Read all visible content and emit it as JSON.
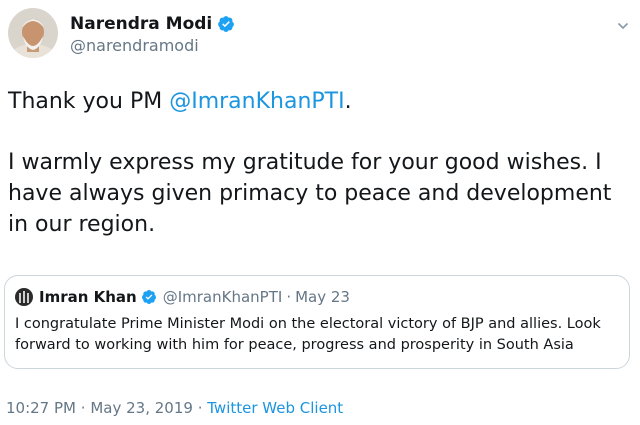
{
  "author": {
    "name": "Narendra Modi",
    "handle": "@narendramodi",
    "verified": true,
    "avatar_icon": "profile-photo"
  },
  "tweet": {
    "line1_prefix": "Thank you PM ",
    "line1_mention": "@ImranKhanPTI",
    "line1_suffix": ".",
    "paragraph2": "I warmly express my gratitude for your good wishes. I have always given primacy to peace and development in our region."
  },
  "quoted_tweet": {
    "name": "Imran Khan",
    "handle": "@ImranKhanPTI",
    "separator": "·",
    "date": "May 23",
    "text": "I congratulate Prime Minister Modi on the electoral victory of BJP and allies. Look forward to working with him for peace, progress and prosperity in South Asia"
  },
  "meta": {
    "time": "10:27 PM",
    "separator": "·",
    "date": "May 23, 2019",
    "source": "Twitter Web Client"
  },
  "colors": {
    "link": "#1b95e0",
    "secondary_text": "#657786",
    "border": "#ccd6dd",
    "verified_badge": "#1da1f2"
  }
}
